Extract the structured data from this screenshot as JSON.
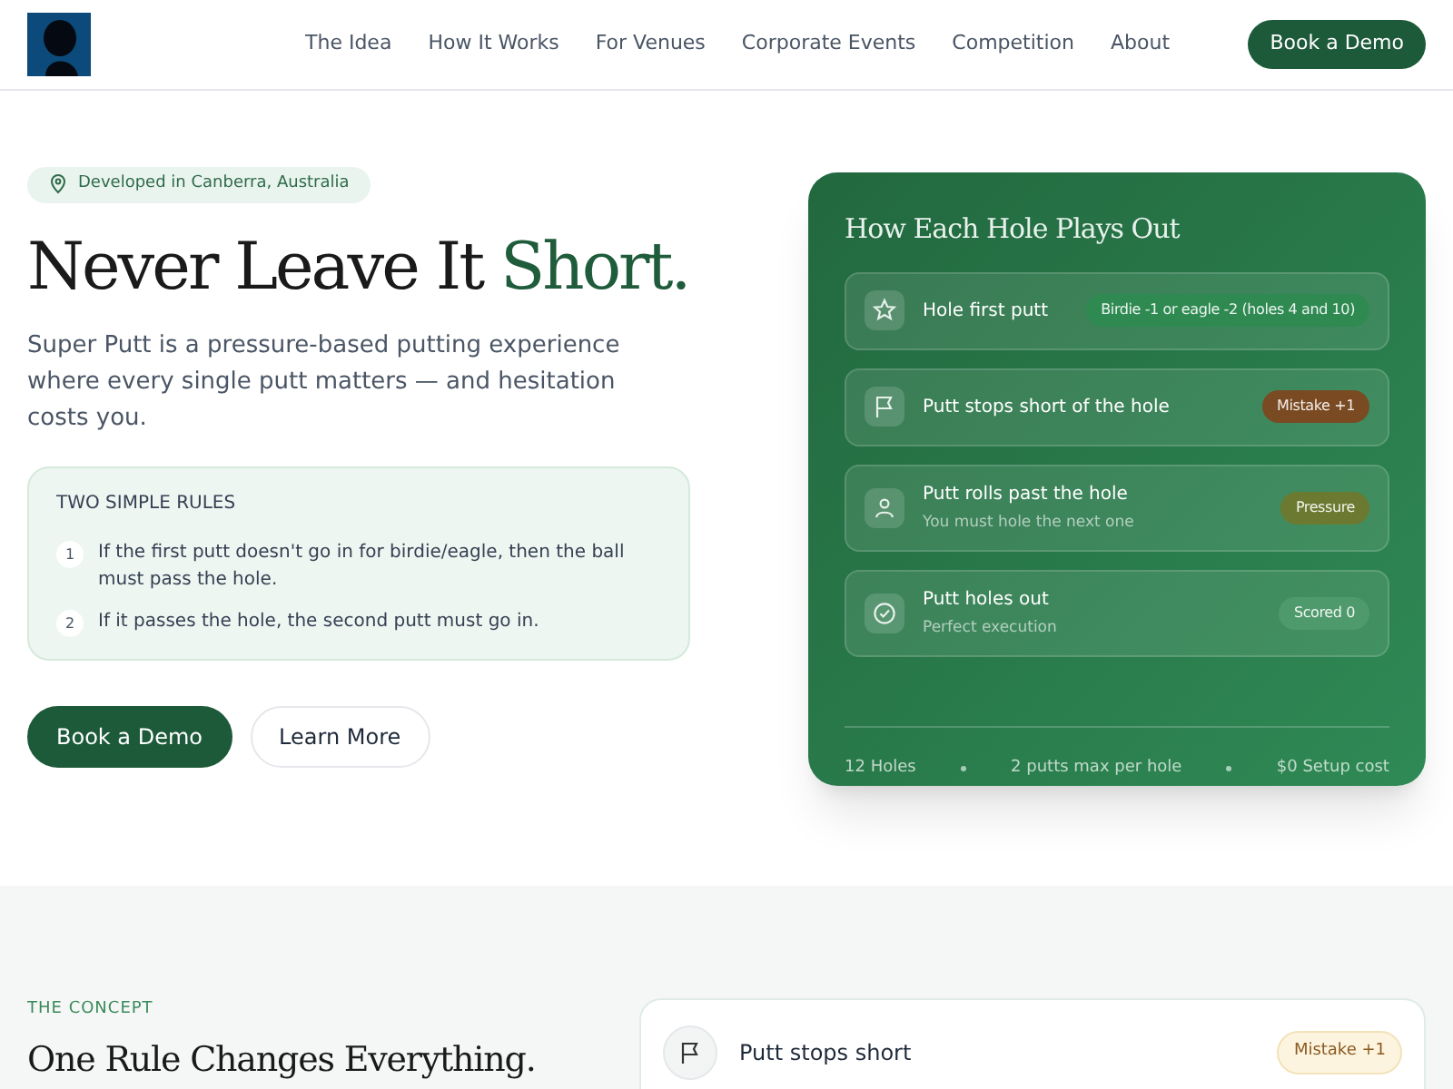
{
  "nav": {
    "links": [
      "The Idea",
      "How It Works",
      "For Venues",
      "Corporate Events",
      "Competition",
      "About"
    ],
    "cta": "Book a Demo"
  },
  "hero": {
    "location_badge": "Developed in Canberra, Australia",
    "title": "Never Leave It",
    "title_accent": "Short.",
    "intro": "Super Putt is a pressure-based putting experience where every single putt matters — and hesitation costs you.",
    "rules": {
      "heading": "TWO SIMPLE RULES",
      "items": [
        {
          "number": "1",
          "text": "If the first putt doesn't go in for birdie/eagle, then the ball must pass the hole."
        },
        {
          "number": "2",
          "text": "If it passes the hole, the second putt must go in."
        }
      ]
    },
    "buttons": [
      {
        "label": "Book a Demo",
        "kind": "primary"
      },
      {
        "label": "Learn More",
        "kind": "secondary"
      }
    ]
  },
  "card": {
    "title": "How Each Hole Plays Out",
    "rows": [
      {
        "kind": "star",
        "title": "Hole first putt",
        "badge": "Birdie -1 or eagle -2 (holes 4 and 10)",
        "color": "#2f8a52"
      },
      {
        "kind": "flag",
        "title": "Putt stops short of the hole",
        "badge": "Mistake +1",
        "color": "#7a4a22"
      },
      {
        "kind": "person",
        "title": "Putt rolls past the hole",
        "subtitle": "You must hole the next one",
        "badge": "Pressure",
        "color": "#6b7a30"
      },
      {
        "kind": "check",
        "title": "Putt holes out",
        "subtitle": "Perfect execution",
        "badge": "Scored 0",
        "color": "#4f9a6c"
      }
    ],
    "stats": [
      "12 Holes",
      "2 putts max per hole",
      "$0 Setup cost"
    ]
  },
  "concept": {
    "eyebrow": "THE CONCEPT",
    "heading": "One Rule Changes Everything.",
    "example": {
      "kind": "flag",
      "title": "Putt stops short",
      "badge": "Mistake +1"
    }
  }
}
